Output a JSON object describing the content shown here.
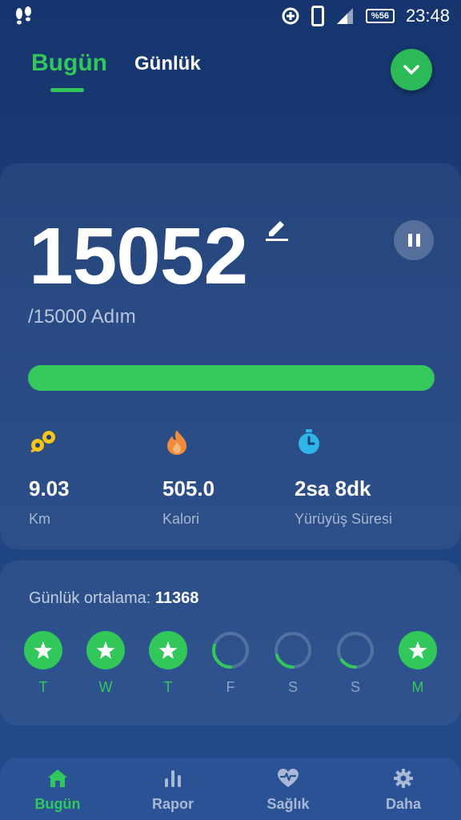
{
  "status_bar": {
    "battery": "%56",
    "time": "23:48"
  },
  "header": {
    "tabs": [
      {
        "label": "Bugün",
        "active": true
      },
      {
        "label": "Günlük",
        "active": false
      }
    ]
  },
  "today": {
    "steps": "15052",
    "goal_text": "/15000 Adım",
    "progress_fraction": 1.0,
    "stats": [
      {
        "value": "9.03",
        "label": "Km",
        "icon": "footprint-distance-icon"
      },
      {
        "value": "505.0",
        "label": "Kalori",
        "icon": "flame-icon"
      },
      {
        "value": "2sa 8dk",
        "label": "Yürüyüş Süresi",
        "icon": "stopwatch-icon"
      }
    ]
  },
  "weekly": {
    "average_label": "Günlük ortalama:",
    "average_value": "11368",
    "days": [
      {
        "label": "T",
        "goal_met": true,
        "progress": 1.0
      },
      {
        "label": "W",
        "goal_met": true,
        "progress": 1.0
      },
      {
        "label": "T",
        "goal_met": true,
        "progress": 1.0
      },
      {
        "label": "F",
        "goal_met": false,
        "progress": 0.3
      },
      {
        "label": "S",
        "goal_met": false,
        "progress": 0.2
      },
      {
        "label": "S",
        "goal_met": false,
        "progress": 0.15
      },
      {
        "label": "M",
        "goal_met": true,
        "progress": 1.0
      }
    ]
  },
  "bottom_nav": [
    {
      "label": "Bugün",
      "icon": "home-icon",
      "active": true
    },
    {
      "label": "Rapor",
      "icon": "bar-chart-icon",
      "active": false
    },
    {
      "label": "Sağlık",
      "icon": "heart-pulse-icon",
      "active": false
    },
    {
      "label": "Daha",
      "icon": "gear-icon",
      "active": false
    }
  ],
  "colors": {
    "accent": "#32c75a",
    "background": "#1c3f7c",
    "nav_background": "#2a5294",
    "inactive_text": "#a8b9d6"
  }
}
